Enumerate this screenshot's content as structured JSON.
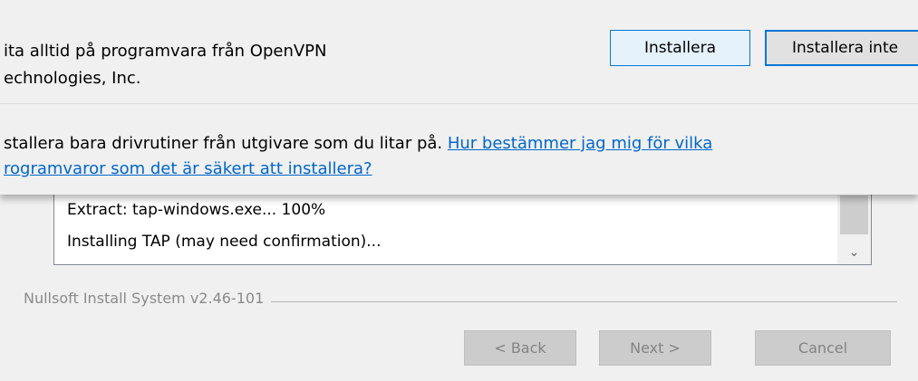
{
  "security_dialog": {
    "trust_line1": "ita alltid på programvara från OpenVPN",
    "trust_line2": "echnologies, Inc.",
    "install_label": "Installera",
    "dont_install_label": "Installera inte",
    "warning_text": "stallera bara drivrutiner från utgivare som du litar på.",
    "help_link_line1": "Hur bestämmer jag mig för vilka",
    "help_link_line2": "rogramvaror som det är säkert att installera?"
  },
  "installer": {
    "log_lines": [
      "Extract: tap-windows.exe... 100%",
      "Installing TAP (may need confirmation)..."
    ],
    "branding": "Nullsoft Install System v2.46-101",
    "back_label": "< Back",
    "next_label": "Next >",
    "cancel_label": "Cancel"
  },
  "colors": {
    "link": "#0066cc",
    "focus_border": "#0078d7",
    "dialog_background": "#f0f0f0"
  },
  "icons": {
    "scroll_down": "chevron-down-icon"
  }
}
